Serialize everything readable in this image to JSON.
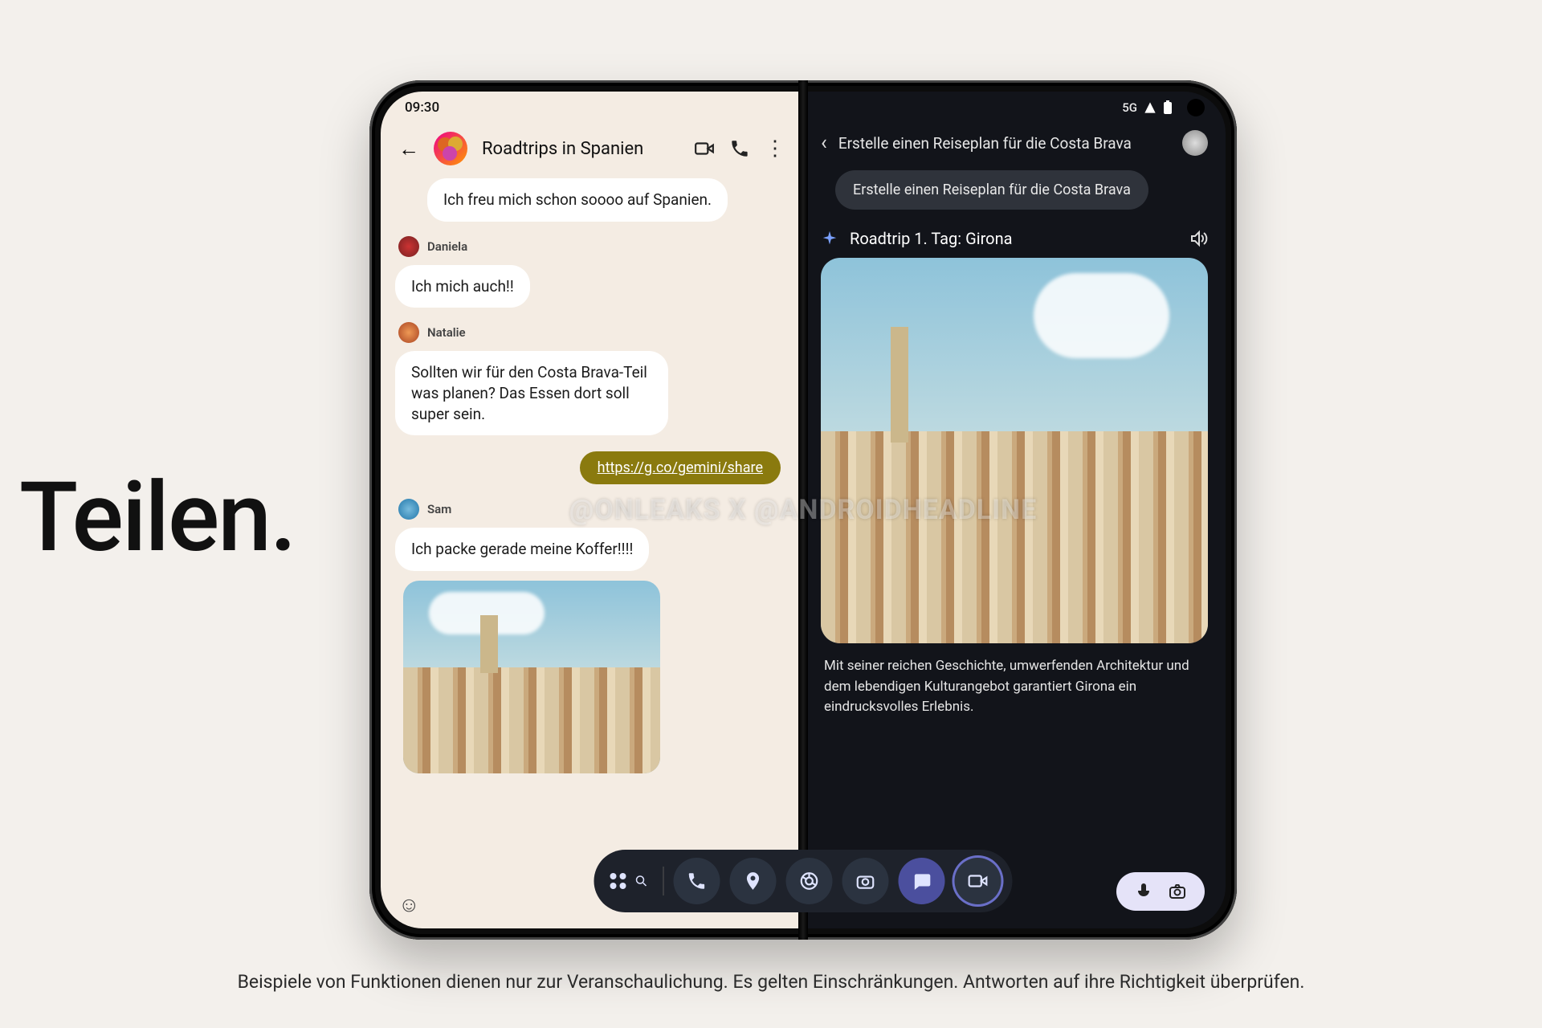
{
  "hero": "Teilen.",
  "disclaimer": "Beispiele von Funktionen dienen nur zur Veranschaulichung. Es gelten Einschränkungen. Antworten auf ihre Richtigkeit überprüfen.",
  "watermark": "@ONLEAKS X @ANDROIDHEADLINE",
  "status": {
    "time": "09:30",
    "network": "5G"
  },
  "chat": {
    "title": "Roadtrips in Spanien",
    "first_message": "Ich freu mich schon soooo auf Spanien.",
    "senders": {
      "daniela": "Daniela",
      "natalie": "Natalie",
      "sam": "Sam"
    },
    "msg_daniela": "Ich mich auch!!",
    "msg_natalie": "Sollten wir für den Costa Brava-Teil was planen? Das Essen dort soll super sein.",
    "share_link": "https://g.co/gemini/share",
    "msg_sam": "Ich packe gerade meine Koffer!!!!"
  },
  "ai": {
    "header": "Erstelle einen Reiseplan für die Costa Brava",
    "prompt": "Erstelle einen Reiseplan für die Costa Brava",
    "response_title": "Roadtrip 1. Tag: Girona",
    "response_text": "Mit seiner reichen Geschichte, umwerfenden Architektur und dem lebendigen Kulturangebot garantiert Girona ein eindrucksvolles Erlebnis."
  }
}
